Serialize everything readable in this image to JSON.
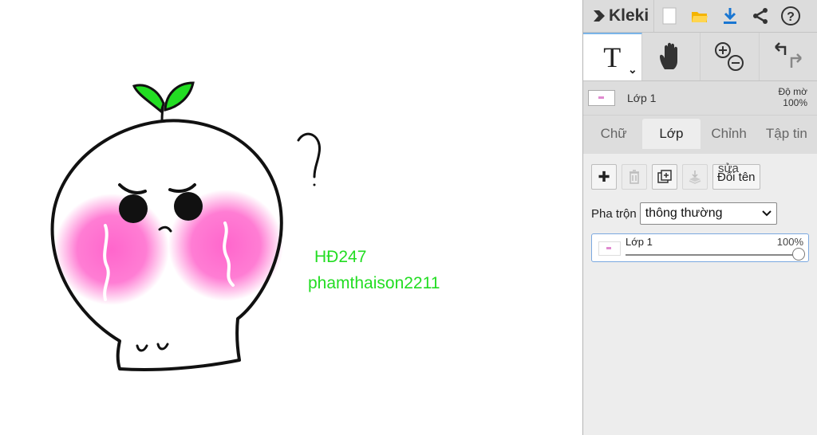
{
  "app": {
    "name": "Kleki"
  },
  "canvas": {
    "texts": [
      "HĐ247",
      "phamthaison2211"
    ],
    "colors": {
      "text": "#22dd22",
      "leaf": "#22dd22",
      "blush": "#ff66cc",
      "outline": "#111111"
    }
  },
  "toolbar": {
    "icons": [
      "new-file-icon",
      "open-folder-icon",
      "download-icon",
      "share-icon",
      "help-icon"
    ]
  },
  "tools": {
    "text_tool_glyph": "T",
    "chevron": "⌄"
  },
  "layer_header": {
    "name": "Lớp 1",
    "opacity_label": "Độ mờ",
    "opacity_value": "100%"
  },
  "tabs": [
    {
      "label": "Chữ",
      "active": false
    },
    {
      "label": "Lớp",
      "active": true
    },
    {
      "label": "Chỉnh",
      "active": false
    },
    {
      "label": "Tập tin",
      "active": false
    }
  ],
  "layers_panel": {
    "rename_label": "Đổi tên",
    "rename_ghost": "sửa",
    "blend_label": "Pha trộn",
    "blend_value": "thông thường",
    "layers": [
      {
        "name": "Lớp 1",
        "opacity": "100%"
      }
    ]
  }
}
